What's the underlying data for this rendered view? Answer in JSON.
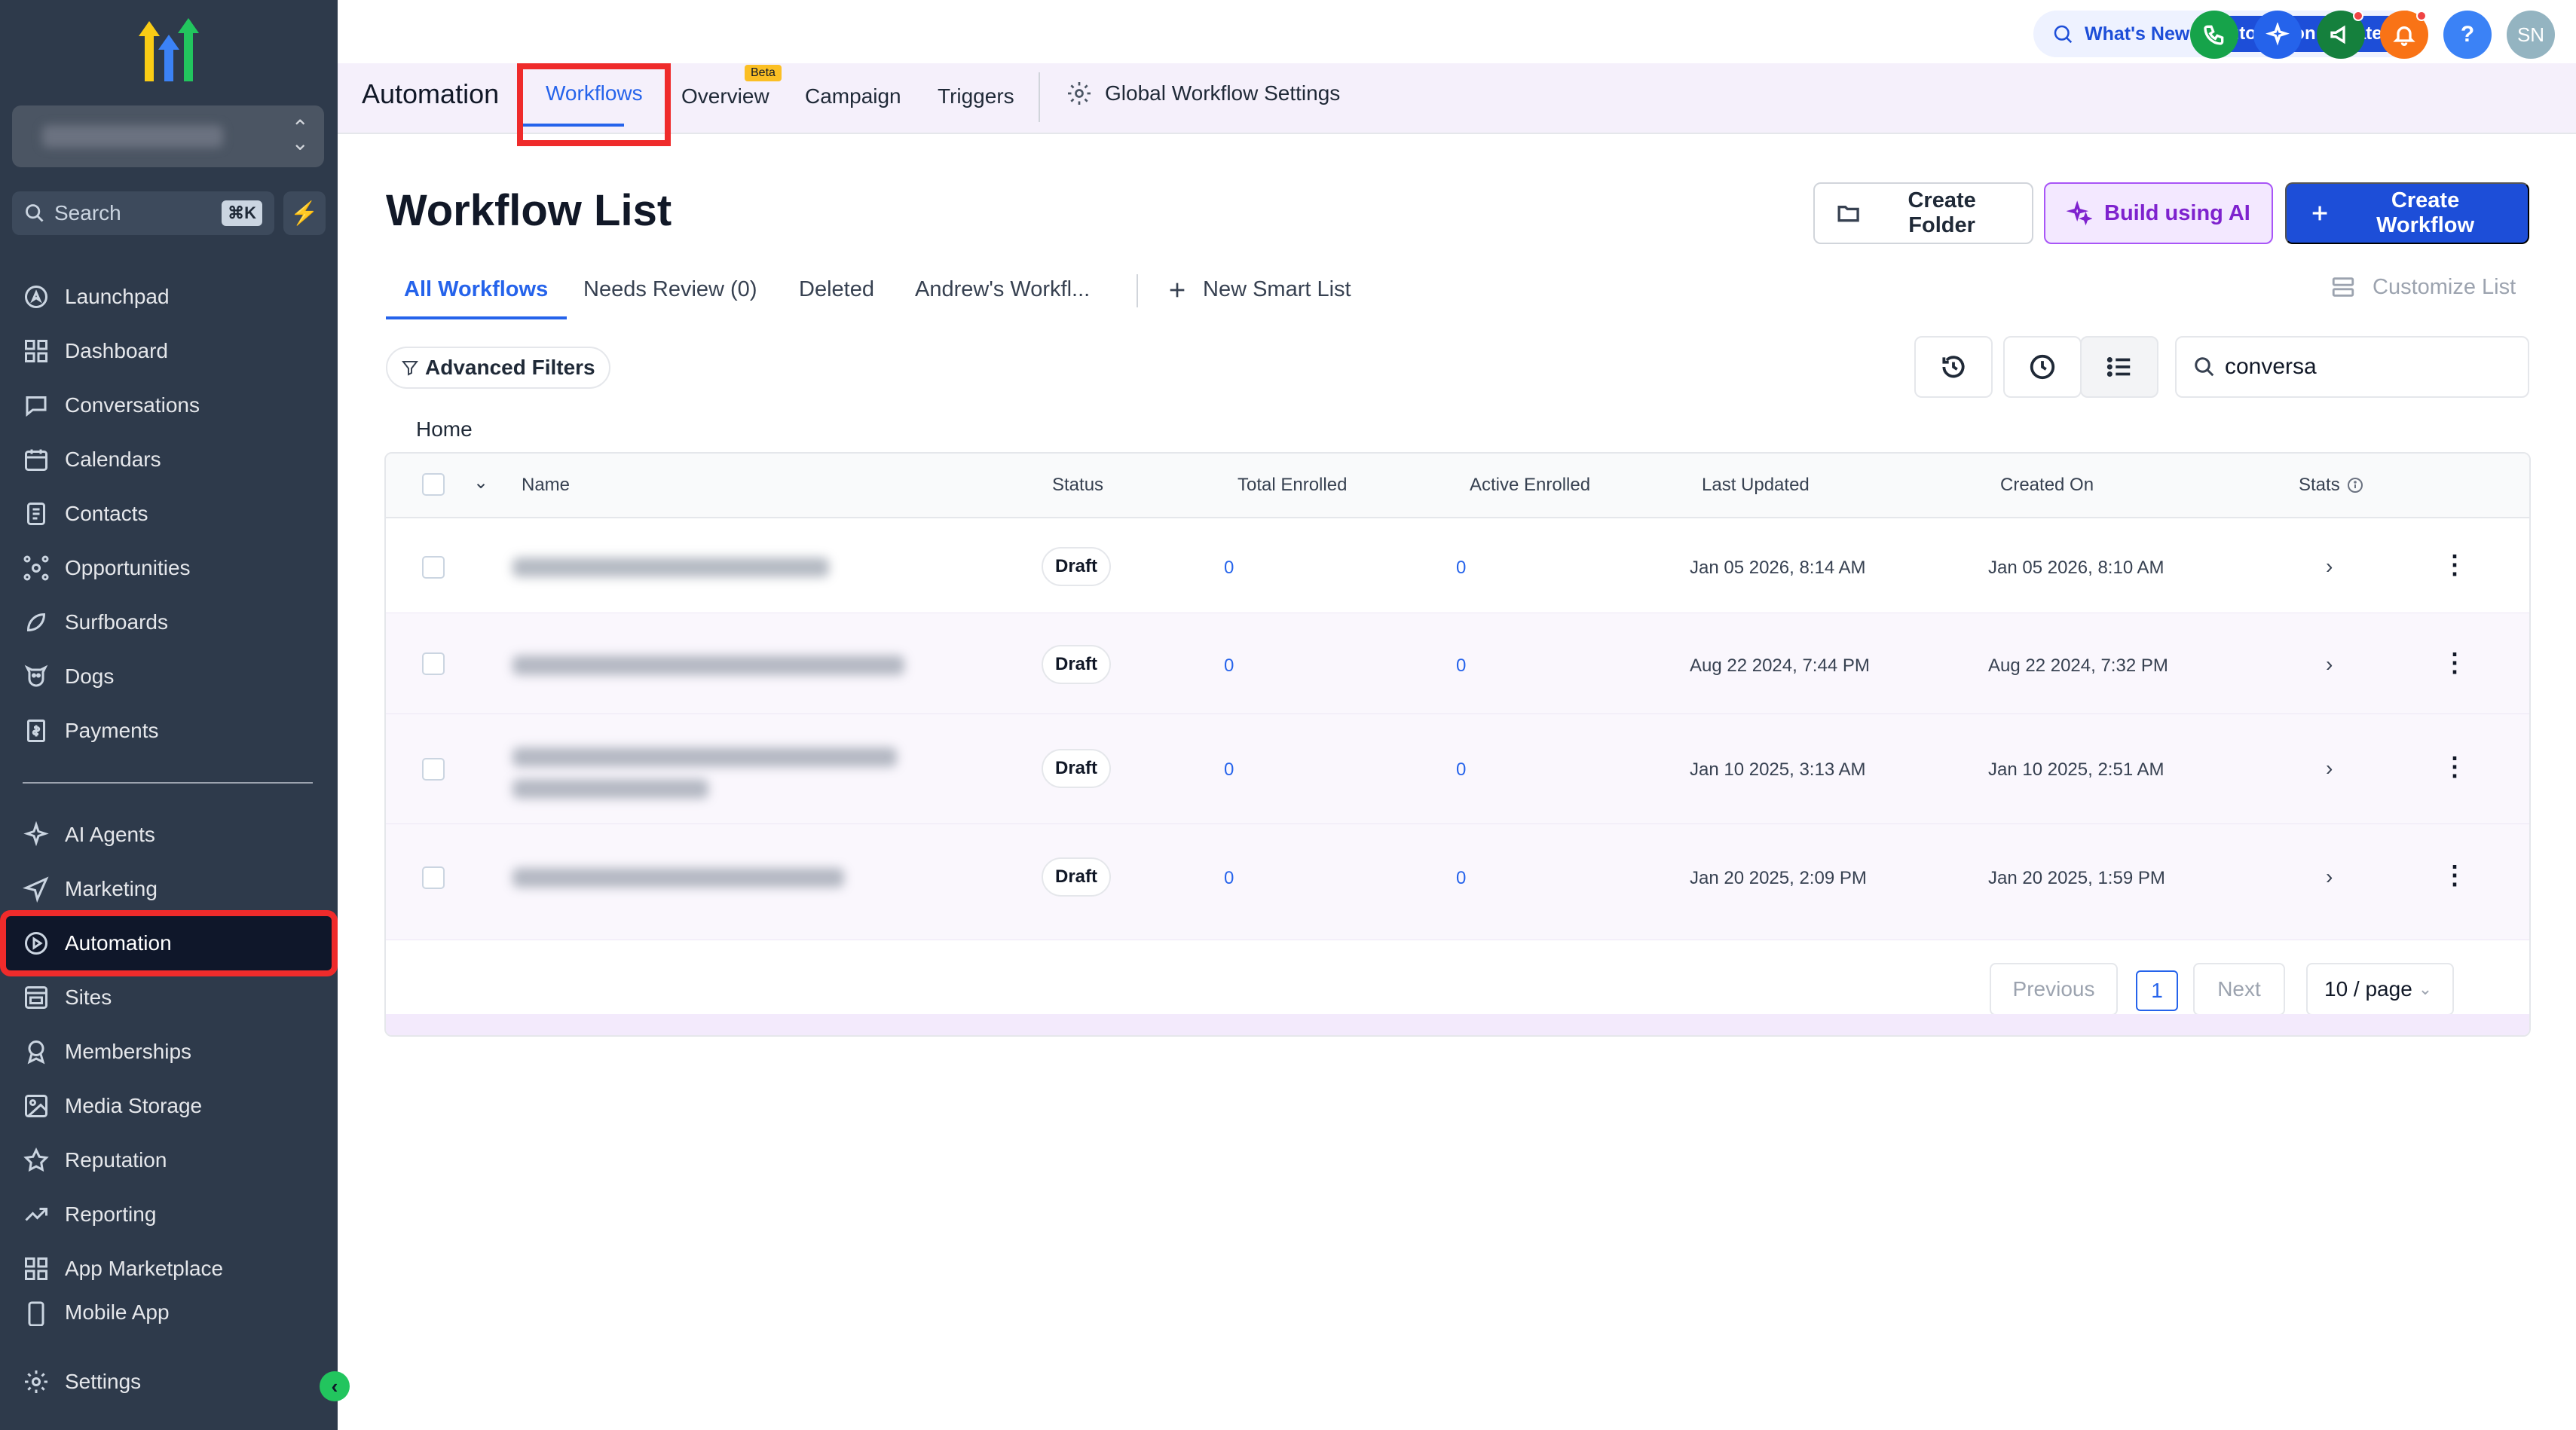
{
  "sidebar": {
    "search_placeholder": "Search",
    "search_shortcut": "⌘K",
    "items_top": [
      {
        "label": "Launchpad",
        "icon": "rocket-icon"
      },
      {
        "label": "Dashboard",
        "icon": "grid-icon"
      },
      {
        "label": "Conversations",
        "icon": "chat-icon"
      },
      {
        "label": "Calendars",
        "icon": "calendar-icon"
      },
      {
        "label": "Contacts",
        "icon": "contacts-icon"
      },
      {
        "label": "Opportunities",
        "icon": "network-icon"
      },
      {
        "label": "Surfboards",
        "icon": "surfboard-icon"
      },
      {
        "label": "Dogs",
        "icon": "dog-icon"
      },
      {
        "label": "Payments",
        "icon": "receipt-icon"
      }
    ],
    "items_bottom": [
      {
        "label": "AI Agents",
        "icon": "sparkle-icon"
      },
      {
        "label": "Marketing",
        "icon": "send-icon"
      },
      {
        "label": "Automation",
        "icon": "automation-icon",
        "active": true
      },
      {
        "label": "Sites",
        "icon": "sites-icon"
      },
      {
        "label": "Memberships",
        "icon": "award-icon"
      },
      {
        "label": "Media Storage",
        "icon": "image-icon"
      },
      {
        "label": "Reputation",
        "icon": "star-icon"
      },
      {
        "label": "Reporting",
        "icon": "trend-icon"
      },
      {
        "label": "App Marketplace",
        "icon": "apps-icon"
      },
      {
        "label": "Mobile App",
        "icon": "phone-icon"
      }
    ],
    "settings_label": "Settings"
  },
  "topbar": {
    "whats_new": "What's New",
    "automation_updates": "Automation Updates",
    "avatar_initials": "SN",
    "help_glyph": "?",
    "colors": {
      "phone": "#16a34a",
      "ai": "#2563eb",
      "megaphone": "#15803d",
      "bell": "#f97316",
      "help": "#3b82f6",
      "avatar": "#94b4c1"
    }
  },
  "subheader": {
    "title": "Automation",
    "tabs": [
      {
        "label": "Workflows",
        "active": true
      },
      {
        "label": "Overview",
        "badge": "Beta"
      },
      {
        "label": "Campaign"
      },
      {
        "label": "Triggers"
      }
    ],
    "global_settings": "Global Workflow Settings"
  },
  "main": {
    "page_title": "Workflow List",
    "buttons": {
      "create_folder": "Create Folder",
      "build_ai": "Build using AI",
      "create_workflow": "Create Workflow"
    },
    "list_tabs": [
      {
        "label": "All Workflows",
        "active": true
      },
      {
        "label": "Needs Review (0)"
      },
      {
        "label": "Deleted"
      },
      {
        "label": "Andrew's Workfl..."
      }
    ],
    "new_smart_list": "New Smart List",
    "customize_list": "Customize List",
    "advanced_filters": "Advanced Filters",
    "search_value": "conversa",
    "breadcrumb": "Home"
  },
  "table": {
    "columns": [
      "Name",
      "Status",
      "Total Enrolled",
      "Active Enrolled",
      "Last Updated",
      "Created On",
      "Stats"
    ],
    "rows": [
      {
        "status": "Draft",
        "total": "0",
        "active": "0",
        "updated": "Jan 05 2026, 8:14 AM",
        "created": "Jan 05 2026, 8:10 AM"
      },
      {
        "status": "Draft",
        "total": "0",
        "active": "0",
        "updated": "Aug 22 2024, 7:44 PM",
        "created": "Aug 22 2024, 7:32 PM"
      },
      {
        "status": "Draft",
        "total": "0",
        "active": "0",
        "updated": "Jan 10 2025, 3:13 AM",
        "created": "Jan 10 2025, 2:51 AM"
      },
      {
        "status": "Draft",
        "total": "0",
        "active": "0",
        "updated": "Jan 20 2025, 2:09 PM",
        "created": "Jan 20 2025, 1:59 PM"
      }
    ]
  },
  "pagination": {
    "previous": "Previous",
    "page": "1",
    "next": "Next",
    "per_page": "10 / page"
  }
}
